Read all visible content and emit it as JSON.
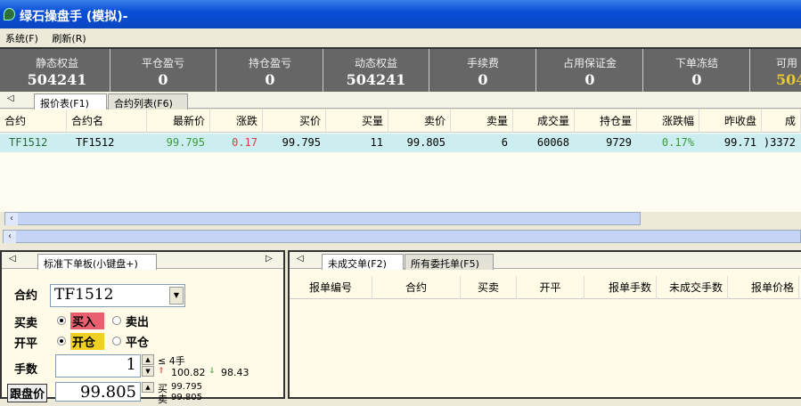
{
  "window": {
    "title": "绿石操盘手 (模拟)-"
  },
  "menu": [
    {
      "label": "系统(F)"
    },
    {
      "label": "刷新(R)"
    }
  ],
  "stats": [
    {
      "label": "静态权益",
      "value": "504241"
    },
    {
      "label": "平仓盈亏",
      "value": "0"
    },
    {
      "label": "持仓盈亏",
      "value": "0"
    },
    {
      "label": "动态权益",
      "value": "504241"
    },
    {
      "label": "手续费",
      "value": "0"
    },
    {
      "label": "占用保证金",
      "value": "0"
    },
    {
      "label": "下单冻结",
      "value": "0"
    },
    {
      "label": "可用",
      "value": "504"
    }
  ],
  "quote_tabs": [
    {
      "label": "报价表(F1)"
    },
    {
      "label": "合约列表(F6)"
    }
  ],
  "quote_headers": [
    "合约",
    "合约名",
    "最新价",
    "涨跌",
    "买价",
    "买量",
    "卖价",
    "卖量",
    "成交量",
    "持仓量",
    "涨跌幅",
    "昨收盘",
    "成"
  ],
  "quote_rows": [
    [
      "TF1512",
      "TF1512",
      "99.795",
      "0.17",
      "99.795",
      "11",
      "99.805",
      "6",
      "60068",
      "9729",
      "0.17%",
      "99.71",
      ")3372"
    ]
  ],
  "colors": {
    "up": "#3a9a3a",
    "down": "#d04040",
    "yellow": "#e8c830"
  },
  "order_panel": {
    "tab": "标准下单板(小键盘+)",
    "contract_label": "合约",
    "contract_value": "TF1512",
    "side_label": "买卖",
    "buy": "买入",
    "sell": "卖出",
    "offset_label": "开平",
    "open": "开仓",
    "close": "平仓",
    "qty_label": "手数",
    "qty_value": "1",
    "max_qty": "≤ 4手",
    "limit_up": "100.82",
    "limit_down": "98.43",
    "price_label": "跟盘价",
    "price_value": "99.805",
    "bid_label": "买",
    "bid": "99.795",
    "ask_label": "卖",
    "ask": "99.805"
  },
  "orders_tabs": [
    {
      "label": "未成交单(F2)"
    },
    {
      "label": "所有委托单(F5)"
    }
  ],
  "orders_headers": [
    "报单编号",
    "合约",
    "买卖",
    "开平",
    "报单手数",
    "未成交手数",
    "报单价格"
  ]
}
